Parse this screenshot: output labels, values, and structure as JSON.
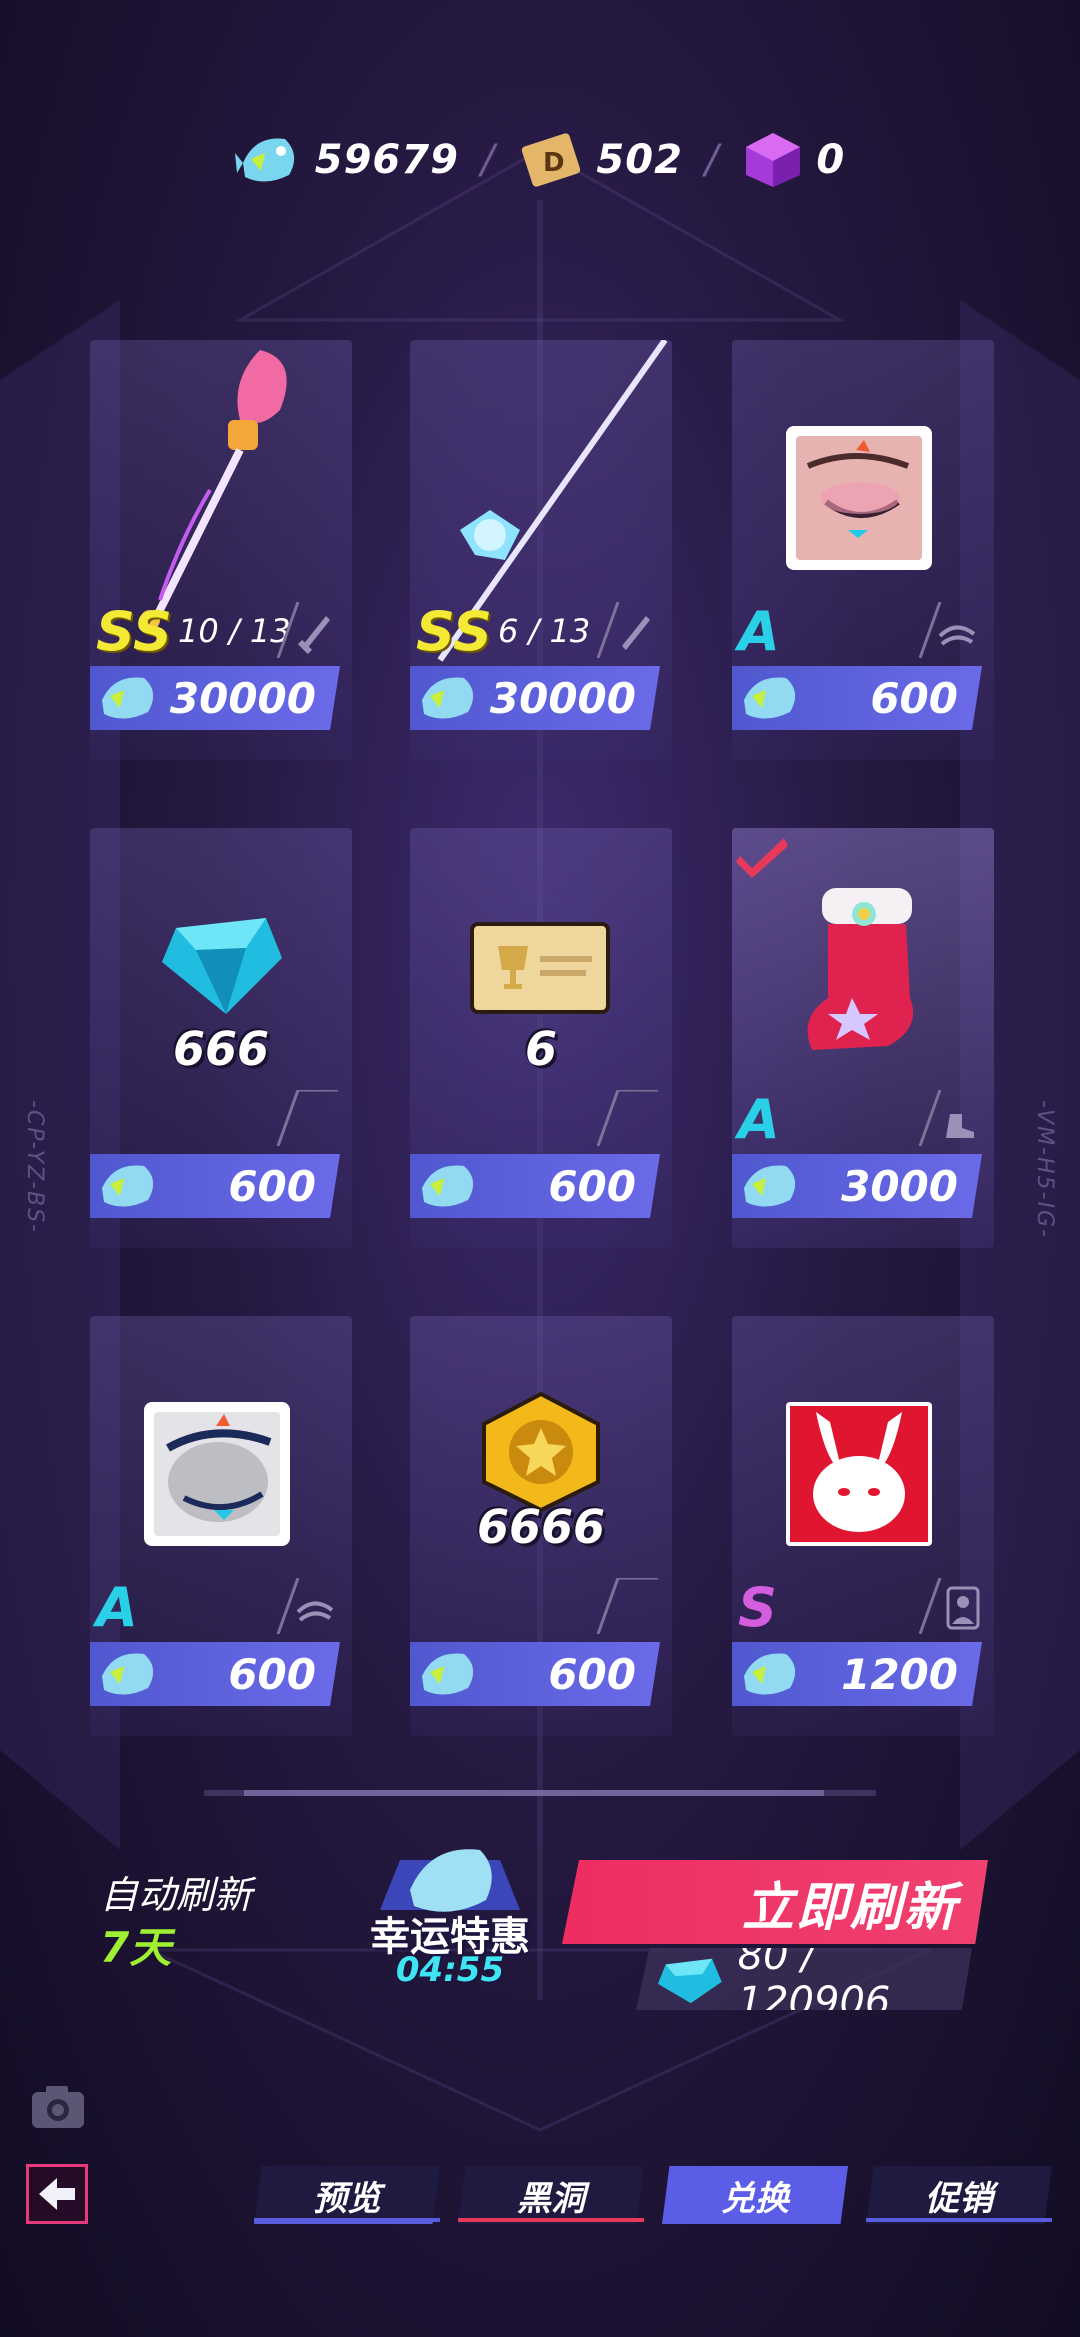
{
  "currencies": [
    {
      "name": "fish-crystal",
      "value": "59679"
    },
    {
      "name": "d-coin",
      "value": "502"
    },
    {
      "name": "purple-cube",
      "value": "0"
    }
  ],
  "side_labels": {
    "left": "-CP-YZ-BS-",
    "right": "-VM-H5-IG-"
  },
  "items": [
    {
      "icon": "pink-wand-weapon-icon",
      "rarity": "SS",
      "count": "10 / 13",
      "type_icon": "sword-icon",
      "price": "30000",
      "qty": ""
    },
    {
      "icon": "ice-spear-weapon-icon",
      "rarity": "SS",
      "count": "6 / 13",
      "type_icon": "sword-icon",
      "price": "30000",
      "qty": ""
    },
    {
      "icon": "closed-eye-face-icon",
      "rarity": "A",
      "count": "",
      "type_icon": "eye-icon",
      "price": "600",
      "qty": ""
    },
    {
      "icon": "blue-diamond-icon",
      "rarity": "",
      "count": "",
      "type_icon": "",
      "price": "600",
      "qty": "666"
    },
    {
      "icon": "event-ticket-icon",
      "rarity": "",
      "count": "",
      "type_icon": "",
      "price": "600",
      "qty": "6"
    },
    {
      "icon": "red-christmas-boot-icon",
      "rarity": "A",
      "count": "",
      "type_icon": "boot-icon",
      "price": "3000",
      "qty": "",
      "selected": true
    },
    {
      "icon": "sleepy-eye-face-icon",
      "rarity": "A",
      "count": "",
      "type_icon": "eye-icon",
      "price": "600",
      "qty": ""
    },
    {
      "icon": "gold-star-coin-icon",
      "rarity": "",
      "count": "",
      "type_icon": "",
      "price": "600",
      "qty": "6666"
    },
    {
      "icon": "bunny-avatar-icon",
      "rarity": "S",
      "count": "",
      "type_icon": "portrait-icon",
      "price": "1200",
      "qty": ""
    }
  ],
  "refresh": {
    "auto_label": "自动刷新",
    "auto_days": "7天",
    "lucky_title": "幸运特惠",
    "lucky_timer": "04:55",
    "button_label": "立即刷新",
    "cost": "80 / 120906"
  },
  "nav": {
    "preview": "预览",
    "blackhole": "黑洞",
    "exchange": "兑换",
    "promo": "促销"
  },
  "colors": {
    "accent_blue": "#5c5de6",
    "refresh_red": "#ee2d62",
    "rarity_ss": "#f4e935",
    "rarity_a": "#29d0e8",
    "rarity_s": "#d45ee0"
  }
}
